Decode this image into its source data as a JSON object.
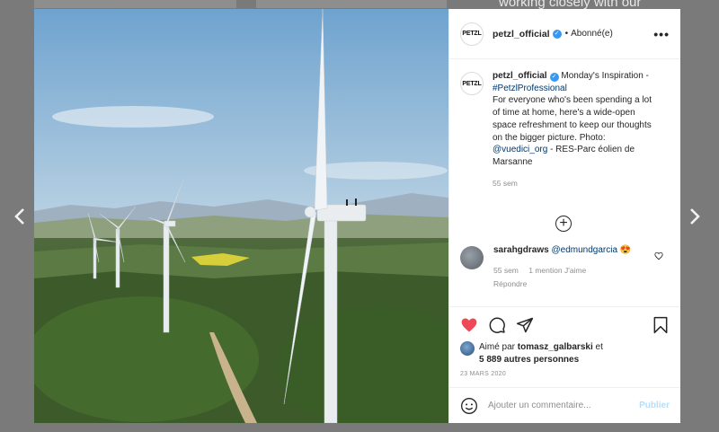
{
  "background": {
    "partial_text": "working closely with our"
  },
  "nav": {
    "prev_icon": "chevron-left-icon",
    "next_icon": "chevron-right-icon"
  },
  "post": {
    "account": {
      "logo_text": "PETZL",
      "username": "petzl_official",
      "verified": true,
      "separator": "•",
      "follow_status": "Abonné(e)"
    },
    "more_icon": "more-horizontal-icon",
    "caption": {
      "username": "petzl_official",
      "text_1": "Monday's Inspiration - ",
      "hashtag": "#PetzlProfessional",
      "text_2": "For everyone who's been spending a lot of time at home, here's a wide-open space refreshment to keep our thoughts on the bigger picture. Photo: ",
      "mention": "@vuedici_org",
      "text_3": " - RES-Parc éolien de Marsanne",
      "time": "55 sem"
    },
    "load_more_icon": "plus-circle-icon",
    "comment": {
      "username": "sarahgdraws",
      "mention": "@edmundgarcia",
      "emoji": "😍",
      "time": "55 sem",
      "likes": "1 mention J'aime",
      "reply": "Répondre"
    },
    "likes": {
      "prefix": "Aimé par ",
      "user": "tomasz_galbarski",
      "middle": " et",
      "others": "5 889 autres personnes"
    },
    "date": "23 MARS 2020",
    "add_comment": {
      "placeholder": "Ajouter un commentaire...",
      "publish": "Publier"
    },
    "colors": {
      "like": "#ed4956",
      "link": "#00376b",
      "verified": "#3897f0",
      "publish_disabled": "#b2dffc"
    }
  }
}
